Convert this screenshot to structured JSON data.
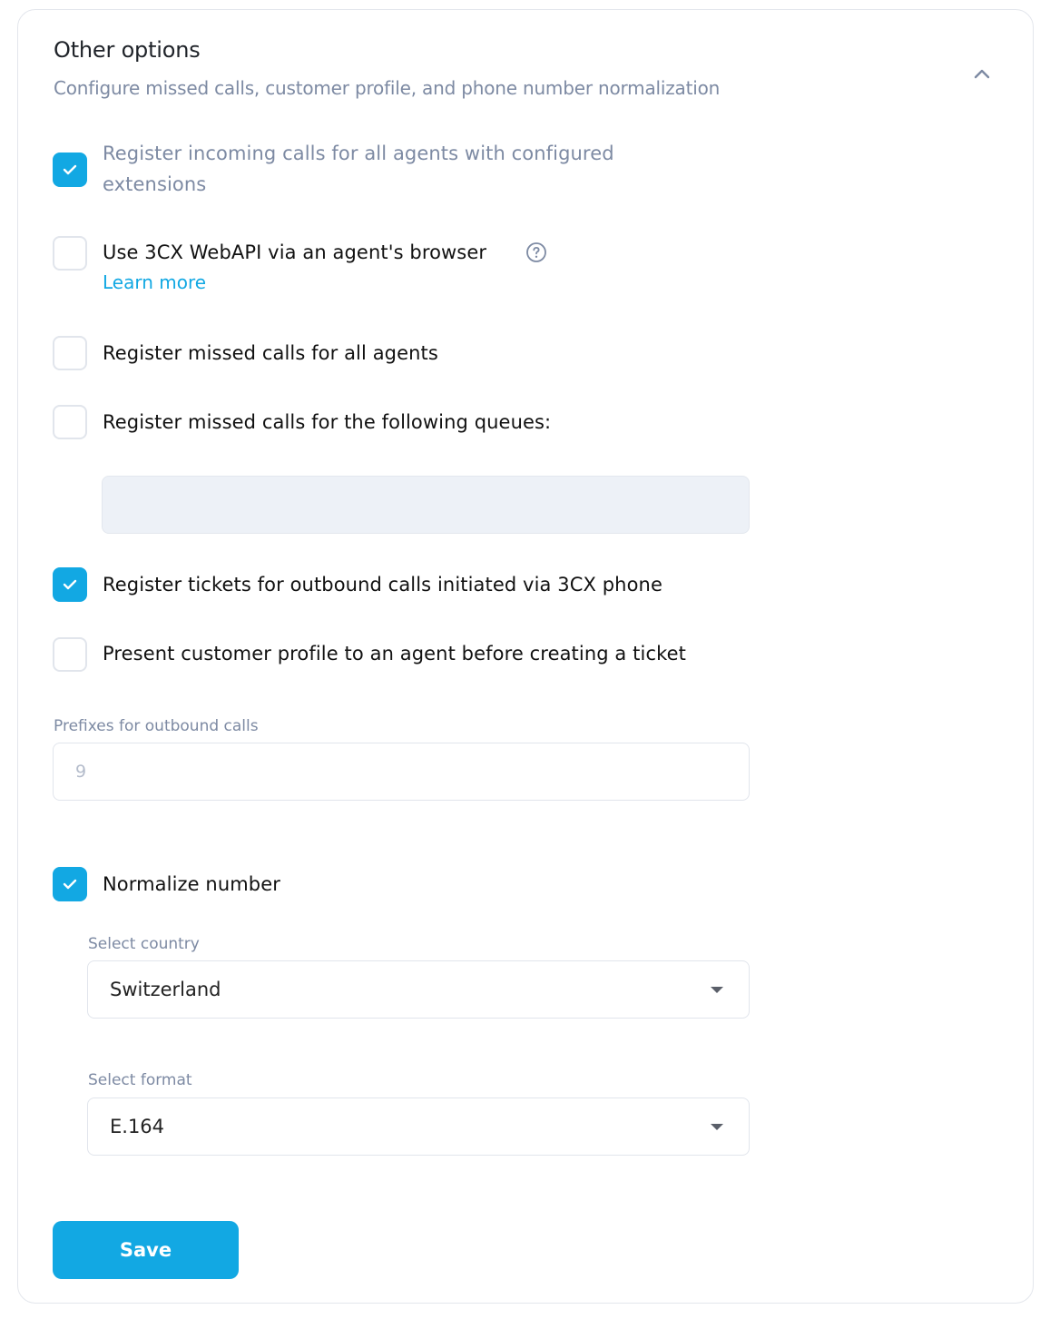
{
  "section": {
    "title": "Other options",
    "subtitle": "Configure missed calls, customer profile, and phone number normalization"
  },
  "options": {
    "incoming_all": {
      "label": "Register incoming calls for all agents with configured extensions",
      "checked": true
    },
    "webapi": {
      "label": "Use 3CX WebAPI via an agent's browser",
      "checked": false,
      "link": "Learn more"
    },
    "missed_all": {
      "label": "Register missed calls for all agents",
      "checked": false
    },
    "missed_queues": {
      "label": "Register missed calls for the following queues:",
      "checked": false,
      "value": ""
    },
    "outbound_tickets": {
      "label": "Register tickets for outbound calls initiated via 3CX phone",
      "checked": true
    },
    "customer_profile": {
      "label": "Present customer profile to an agent before creating a ticket",
      "checked": false
    }
  },
  "prefixes": {
    "label": "Prefixes for outbound calls",
    "placeholder": "9",
    "value": ""
  },
  "normalize": {
    "label": "Normalize number",
    "checked": true,
    "country": {
      "label": "Select country",
      "value": "Switzerland"
    },
    "format": {
      "label": "Select format",
      "value": "E.164"
    }
  },
  "actions": {
    "save_label": "Save"
  },
  "colors": {
    "accent": "#12a8e3",
    "muted_text": "#7d8aa3",
    "border": "#e1e5ec"
  }
}
